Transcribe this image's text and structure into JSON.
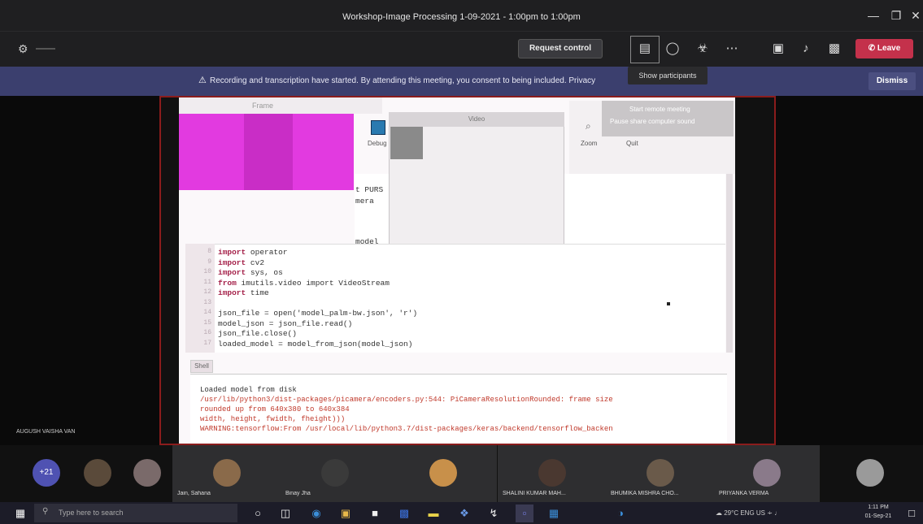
{
  "window": {
    "title": "Workshop-Image Processing 1-09-2021 - 1:00pm to 1:00pm"
  },
  "toolbar": {
    "request_control": "Request control",
    "leave": "Leave",
    "icons": [
      "show-participants-icon",
      "chat-icon",
      "reactions-icon",
      "more-options-icon",
      "camera-icon",
      "mic-icon",
      "share-icon"
    ],
    "tooltip": "Show participants"
  },
  "banner": {
    "text": "Recording and transcription have started. By attending this meeting, you consent to being included. Privacy",
    "dismiss": "Dismiss"
  },
  "shared_screen": {
    "share_menu": [
      "Start remote meeting",
      "Pause share computer sound"
    ],
    "window_title": "Frame",
    "video_title": "Video",
    "ui_labels": [
      "Debug",
      "Zoom",
      "Quit"
    ],
    "partial_code": [
      "t PURS",
      "mera",
      "model_"
    ],
    "code_lines": [
      {
        "n": "8",
        "kw": "import",
        "rest": " operator"
      },
      {
        "n": "9",
        "kw": "import",
        "rest": " cv2"
      },
      {
        "n": "10",
        "kw": "import",
        "rest": " sys, os"
      },
      {
        "n": "11",
        "kw": "from",
        "rest": " imutils.video import VideoStream"
      },
      {
        "n": "12",
        "kw": "import",
        "rest": " time"
      },
      {
        "n": "13",
        "kw": "",
        "rest": ""
      },
      {
        "n": "14",
        "kw": "",
        "rest": "json_file = open('model_palm-bw.json', 'r')"
      },
      {
        "n": "15",
        "kw": "",
        "rest": "model_json = json_file.read()"
      },
      {
        "n": "16",
        "kw": "",
        "rest": "json_file.close()"
      },
      {
        "n": "17",
        "kw": "",
        "rest": "loaded_model = model_from_json(model_json)"
      }
    ],
    "shell_tab": "Shell",
    "shell_lines": [
      {
        "text": "Loaded model from disk",
        "color": "#333"
      },
      {
        "text": "/usr/lib/python3/dist-packages/picamera/encoders.py:544: PiCameraResolutionRounded: frame size",
        "color": "#c0392b"
      },
      {
        "text": "rounded up from 640x380 to 640x384",
        "color": "#c0392b"
      },
      {
        "text": "  width, height, fwidth, fheight)))",
        "color": "#c0392b"
      },
      {
        "text": "WARNING:tensorflow:From /usr/local/lib/python3.7/dist-packages/keras/backend/tensorflow_backen",
        "color": "#c0392b"
      }
    ],
    "presenter_name": "AUGUSH VAISHA VAN"
  },
  "participants": [
    {
      "initials": "+21",
      "name": "",
      "color": "#4f52b2"
    },
    {
      "initials": "",
      "name": "",
      "color": "#5a4a3a"
    },
    {
      "initials": "",
      "name": "",
      "color": "#7a6a6a"
    },
    {
      "initials": "",
      "name": "Jain, Sahana",
      "color": "#8a6a4a"
    },
    {
      "initials": "",
      "name": "Binay Jha",
      "color": "#3a3a3a"
    },
    {
      "initials": "",
      "name": "",
      "color": "#c8904a"
    },
    {
      "initials": "",
      "name": "SHALINI KUMAR MAH...",
      "color": "#4a3830"
    },
    {
      "initials": "",
      "name": "BHUMIKA MISHRA CHO...",
      "color": "#6a5a4a"
    },
    {
      "initials": "",
      "name": "PRIYANKA VERMA",
      "color": "#8a7a8a"
    },
    {
      "initials": "",
      "name": "",
      "color": "#9a9a9a"
    }
  ],
  "taskbar": {
    "search_placeholder": "Type here to search",
    "tray_text": "29°C  ENG  US",
    "time": "1:11 PM",
    "date": "01-Sep-21"
  }
}
